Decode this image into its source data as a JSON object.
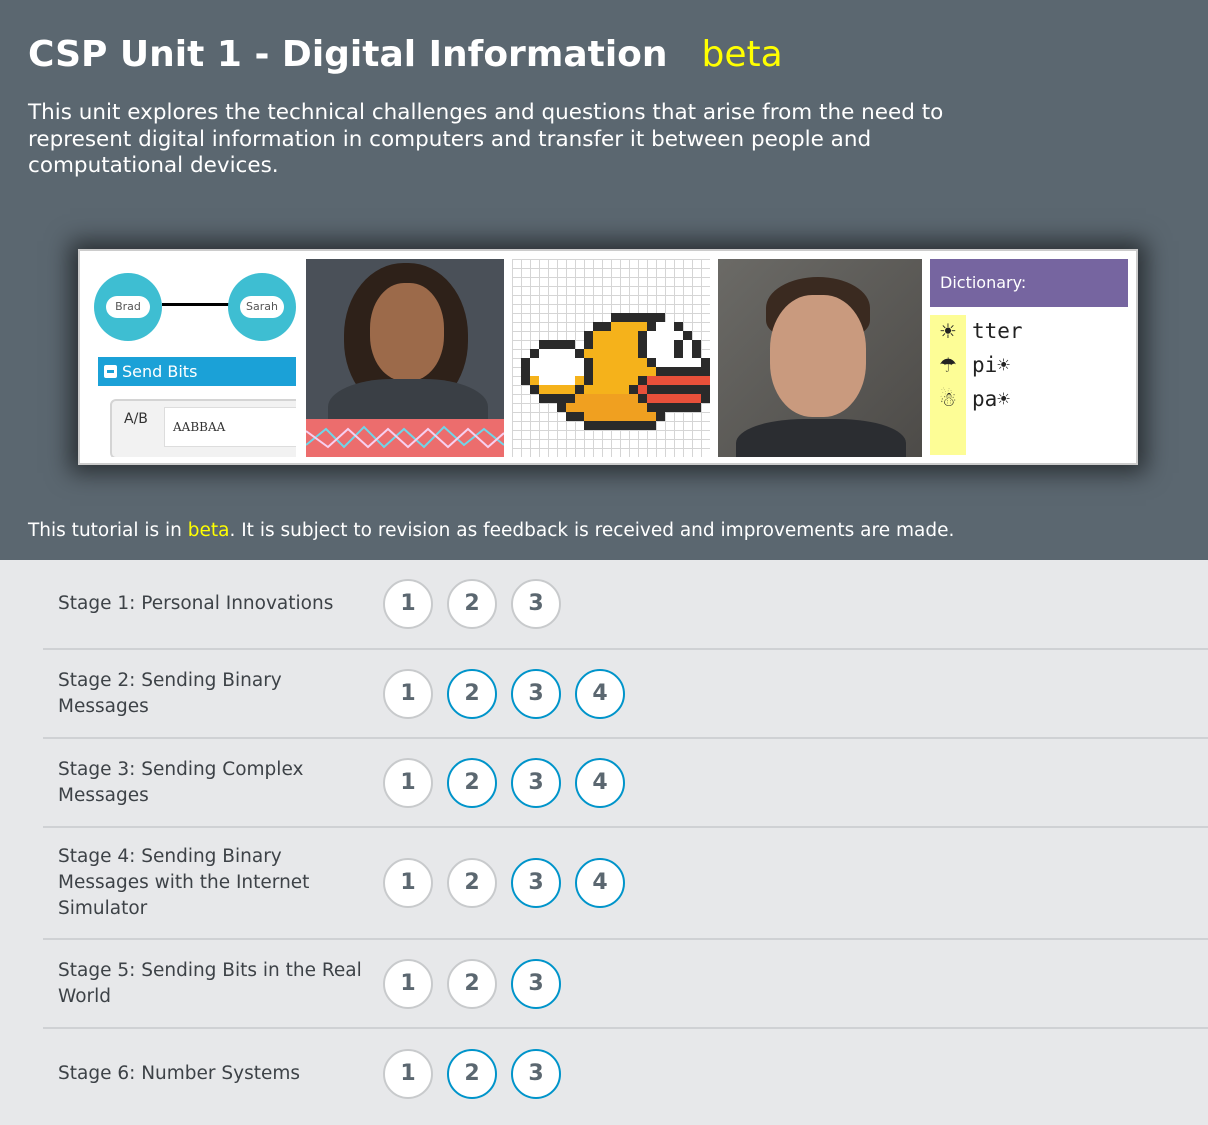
{
  "header": {
    "title": "CSP Unit 1 - Digital Information",
    "beta_label": "beta",
    "description": "This unit explores the technical challenges and questions that arise from the need to represent digital information in computers and transfer it between people and computational devices."
  },
  "banner": {
    "internet_sim": {
      "node_a": "Brad",
      "node_b": "Sarah",
      "send_bits_label": "Send Bits",
      "ab_label": "A/B",
      "ab_value": "AABBAA"
    },
    "dictionary": {
      "heading": "Dictionary:",
      "entries": [
        {
          "icon": "sun-icon",
          "glyph": "☀",
          "text": "tter"
        },
        {
          "icon": "umbrella-icon",
          "glyph": "☂",
          "text": "pi☀"
        },
        {
          "icon": "snowman-icon",
          "glyph": "☃",
          "text": "pa☀"
        }
      ]
    }
  },
  "beta_note": {
    "before": "This tutorial is in ",
    "highlight": "beta",
    "after": ". It is subject to revision as feedback is received and improvements are made."
  },
  "colors": {
    "header_bg": "#5b6770",
    "beta_yellow": "#ffff00",
    "body_bg": "#e7e8ea",
    "bubble_blue": "#0094ca",
    "bubble_gray": "#c8cacc"
  },
  "stages": [
    {
      "name": "Stage 1: Personal Innovations",
      "levels": [
        {
          "n": "1",
          "style": "gray"
        },
        {
          "n": "2",
          "style": "gray"
        },
        {
          "n": "3",
          "style": "gray"
        }
      ]
    },
    {
      "name": "Stage 2: Sending Binary Messages",
      "levels": [
        {
          "n": "1",
          "style": "gray"
        },
        {
          "n": "2",
          "style": "blue"
        },
        {
          "n": "3",
          "style": "blue"
        },
        {
          "n": "4",
          "style": "blue"
        }
      ]
    },
    {
      "name": "Stage 3: Sending Complex Messages",
      "levels": [
        {
          "n": "1",
          "style": "gray"
        },
        {
          "n": "2",
          "style": "blue"
        },
        {
          "n": "3",
          "style": "blue"
        },
        {
          "n": "4",
          "style": "blue"
        }
      ]
    },
    {
      "name": "Stage 4: Sending Binary Messages with the Internet Simulator",
      "levels": [
        {
          "n": "1",
          "style": "gray"
        },
        {
          "n": "2",
          "style": "gray"
        },
        {
          "n": "3",
          "style": "blue"
        },
        {
          "n": "4",
          "style": "blue"
        }
      ]
    },
    {
      "name": "Stage 5: Sending Bits in the Real World",
      "levels": [
        {
          "n": "1",
          "style": "gray"
        },
        {
          "n": "2",
          "style": "gray"
        },
        {
          "n": "3",
          "style": "blue"
        }
      ]
    },
    {
      "name": "Stage 6: Number Systems",
      "levels": [
        {
          "n": "1",
          "style": "gray"
        },
        {
          "n": "2",
          "style": "blue"
        },
        {
          "n": "3",
          "style": "blue"
        }
      ]
    }
  ]
}
